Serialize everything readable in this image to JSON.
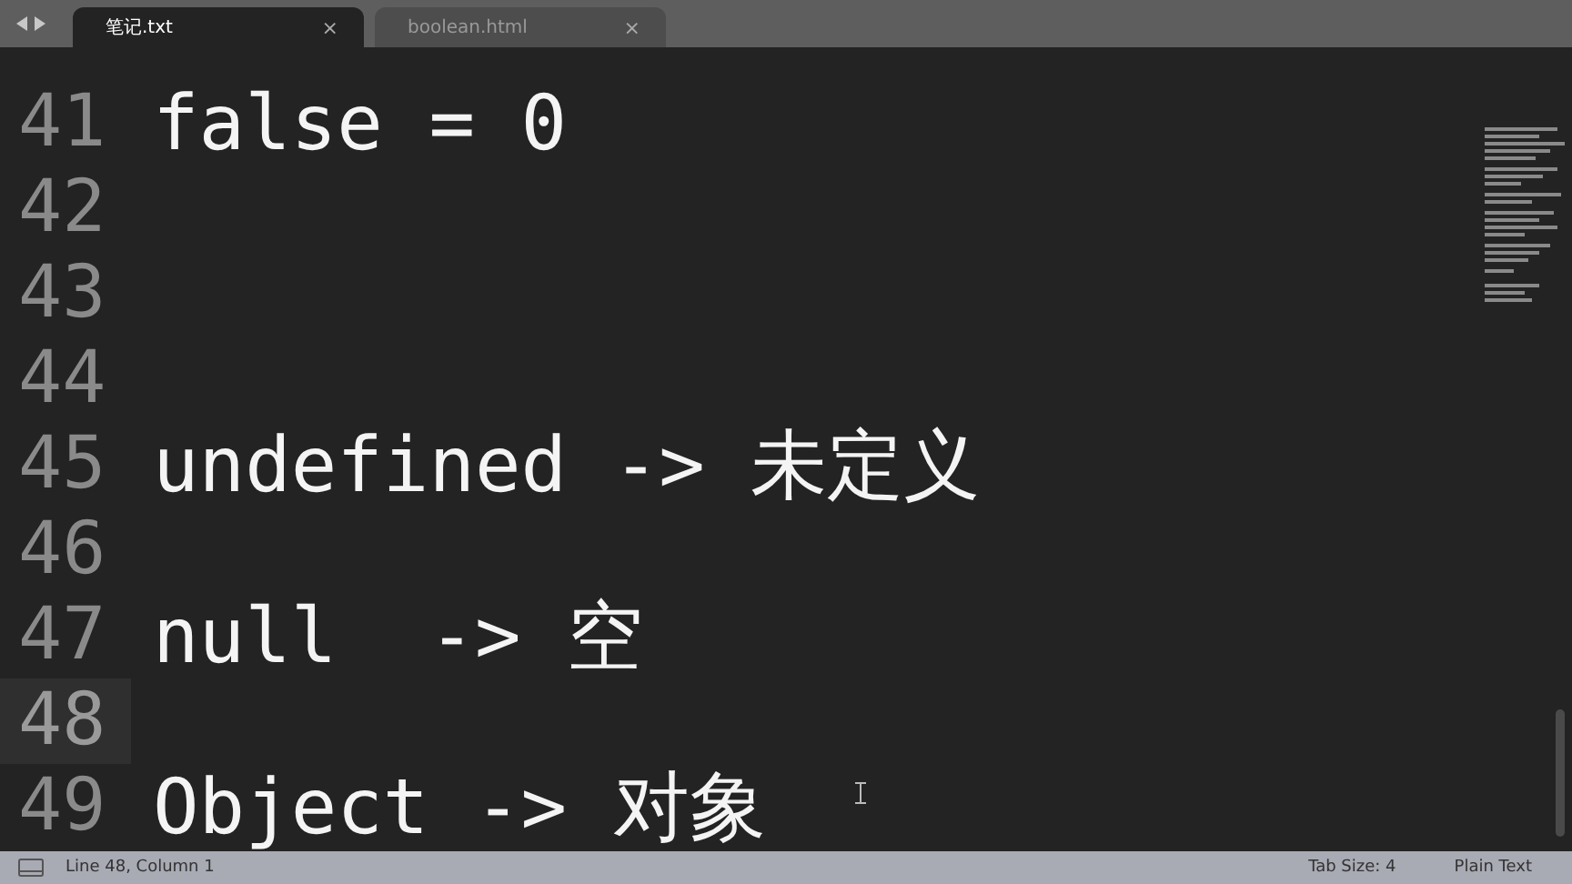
{
  "tabs": [
    {
      "label": "笔记.txt",
      "close": "×",
      "selected": true
    },
    {
      "label": "boolean.html",
      "close": "×",
      "selected": false
    }
  ],
  "editor": {
    "lines": [
      {
        "number": "41",
        "text": "false = 0",
        "current": false
      },
      {
        "number": "42",
        "current": false
      },
      {
        "number": "43",
        "current": false
      },
      {
        "number": "44",
        "current": false
      },
      {
        "number": "45",
        "text": "undefined -> 未定义",
        "current": false
      },
      {
        "number": "46",
        "current": false
      },
      {
        "number": "47",
        "text": "null  -> 空",
        "current": false
      },
      {
        "number": "48",
        "current": true
      },
      {
        "number": "49",
        "text": "Object -> 对象",
        "current": false
      }
    ]
  },
  "status_bar": {
    "position": "Line 48, Column 1",
    "tab_size": "Tab Size: 4",
    "syntax": "Plain Text"
  }
}
